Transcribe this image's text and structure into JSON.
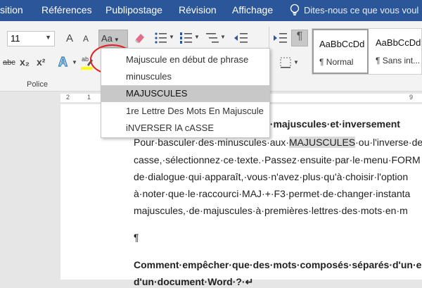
{
  "tabs": [
    "sition",
    "Références",
    "Publipostage",
    "Révision",
    "Affichage"
  ],
  "tell_me": "Dites-nous ce que vous voul",
  "ribbon": {
    "font_size": "11",
    "grow_font": "A",
    "shrink_font": "A",
    "case_button": "Aa",
    "strike": "abc",
    "subscript": "x₂",
    "superscript": "x²",
    "group_label": "Police",
    "styles": [
      {
        "sample": "AaBbCcDd",
        "name": "¶ Normal"
      },
      {
        "sample": "AaBbCcDd",
        "name": "¶ Sans int..."
      }
    ]
  },
  "ruler_numbers": [
    "2",
    "1",
    "9"
  ],
  "case_menu": {
    "items": [
      {
        "label": "Majuscule en début de phrase",
        "selected": false
      },
      {
        "label": "minuscules",
        "selected": false
      },
      {
        "label": "MAJUSCULES",
        "selected": true
      },
      {
        "label": "1re Lettre Des Mots En Majuscule",
        "selected": false
      },
      {
        "label": "iNVERSER lA cASSE",
        "selected": false
      }
    ]
  },
  "document": {
    "heading_fragment": "s·en·majuscules·et·inversement",
    "p1_pre": "Pour·basculer·des·minuscules·aux·",
    "p1_highlight": "MAJUSCULES",
    "p1_post": "·ou·l'inverse·de",
    "line2": "casse,·sélectionnez·ce·texte.·Passez·ensuite·par·le·menu·FORM",
    "line3": "de·dialogue·qui·apparaît,·vous·n'avez·plus·qu'à·choisir·l'option",
    "line4": "à·noter·que·le·raccourci·MAJ·+·F3·permet·de·changer·instanta",
    "line5": "majuscules,·de·majuscules·à·premières·lettres·des·mots·en·m",
    "pilcrow": "¶",
    "q_line1": "Comment·empêcher·que·des·mots·composés·séparés·d'un·e",
    "q_line2": "d'un·document·Word·?·↵"
  },
  "colors": {
    "ribbon_blue": "#2b579a",
    "highlight_circle": "#e2201f"
  }
}
